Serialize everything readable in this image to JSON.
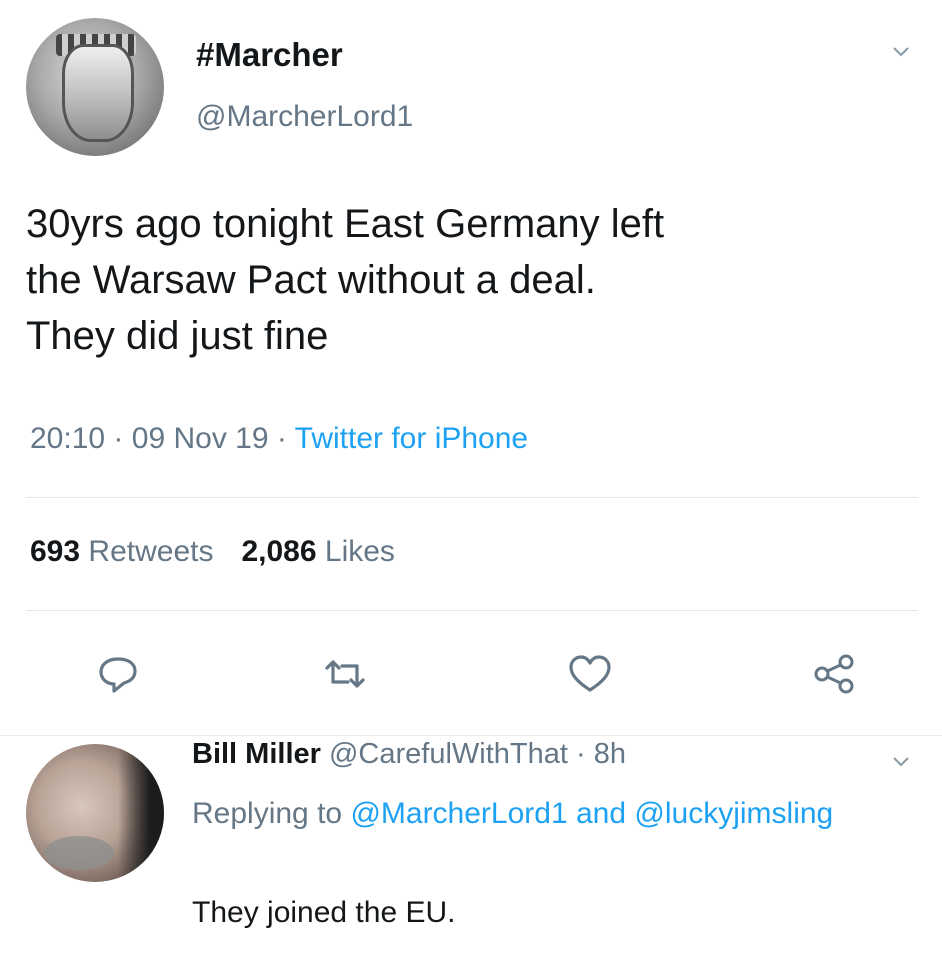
{
  "tweet": {
    "display_name": "#Marcher",
    "handle": "@MarcherLord1",
    "text_lines": [
      "30yrs ago tonight East Germany left",
      "the Warsaw Pact without a deal.",
      "They did just fine"
    ],
    "time": "20:10",
    "date": "09 Nov 19",
    "source": "Twitter for iPhone",
    "separator": "·",
    "retweets_count": "693",
    "retweets_label": "Retweets",
    "likes_count": "2,086",
    "likes_label": "Likes",
    "menu_icon": "chevron-down-icon",
    "actions": [
      "reply-icon",
      "retweet-icon",
      "like-icon",
      "share-icon"
    ]
  },
  "reply": {
    "display_name": "Bill Miller",
    "handle": "@CarefulWithThat",
    "separator": "·",
    "age": "8h",
    "replying_prefix": "Replying to",
    "mention_1": "@MarcherLord1",
    "conjunction": "and",
    "mention_2": "@luckyjimsling",
    "text": "They joined the EU.",
    "menu_icon": "chevron-down-icon"
  },
  "colors": {
    "text": "#14171a",
    "secondary": "#657786",
    "link": "#1da1f2",
    "divider": "#e1e8ed"
  }
}
